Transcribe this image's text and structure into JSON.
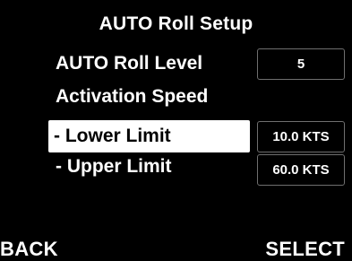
{
  "screen": {
    "title": "AUTO Roll Setup"
  },
  "rows": [
    {
      "label": "AUTO Roll Level",
      "value": "5"
    },
    {
      "label": "Activation Speed"
    },
    {
      "label": "- Lower Limit",
      "value": "10.0 KTS",
      "selected": true
    },
    {
      "label": "- Upper Limit",
      "value": "60.0 KTS"
    }
  ],
  "softkeys": {
    "left": "BACK",
    "right": "SELECT"
  },
  "colors": {
    "background": "#000000",
    "text": "#ffffff",
    "highlight_bg": "#ffffff",
    "highlight_text": "#000000",
    "box_border": "#6f6f6f"
  }
}
